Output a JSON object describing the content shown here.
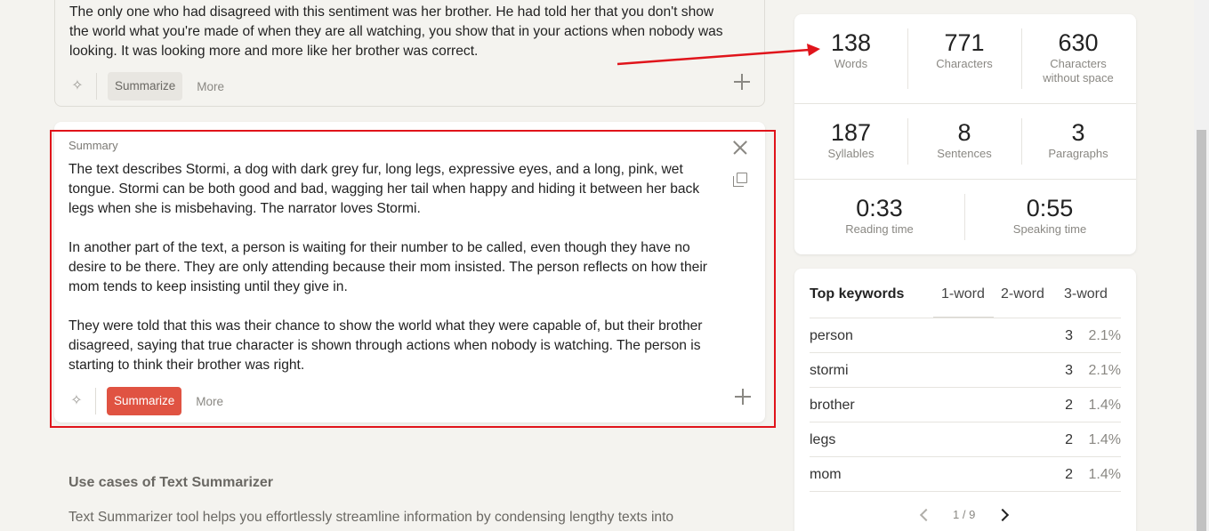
{
  "top_card": {
    "text": "The only one who had disagreed with this sentiment was her brother. He had told her that you don't show the world what you're made of when they are all watching, you show that in your actions when nobody was looking. It was looking more and more like her brother was correct.",
    "summarize_label": "Summarize",
    "more_label": "More"
  },
  "summary_card": {
    "label": "Summary",
    "paragraphs": [
      "The text describes Stormi, a dog with dark grey fur, long legs, expressive eyes, and a long, pink, wet tongue. Stormi can be both good and bad, wagging her tail when happy and hiding it between her back legs when she is misbehaving. The narrator loves Stormi.",
      "In another part of the text, a person is waiting for their number to be called, even though they have no desire to be there. They are only attending because their mom insisted. The person reflects on how their mom tends to keep insisting until they give in.",
      "They were told that this was their chance to show the world what they were capable of, but their brother disagreed, saying that true character is shown through actions when nobody is watching. The person is starting to think their brother was right."
    ],
    "summarize_label": "Summarize",
    "more_label": "More"
  },
  "section": {
    "title": "Use cases of Text Summarizer",
    "text": "Text Summarizer tool helps you effortlessly streamline information by condensing lengthy texts into"
  },
  "stats": {
    "words": {
      "value": "138",
      "label": "Words"
    },
    "characters": {
      "value": "771",
      "label": "Characters"
    },
    "characters_no_space": {
      "value": "630",
      "label_1": "Characters",
      "label_2": "without space"
    },
    "syllables": {
      "value": "187",
      "label": "Syllables"
    },
    "sentences": {
      "value": "8",
      "label": "Sentences"
    },
    "paragraphs": {
      "value": "3",
      "label": "Paragraphs"
    },
    "reading_time": {
      "value": "0:33",
      "label": "Reading time"
    },
    "speaking_time": {
      "value": "0:55",
      "label": "Speaking time"
    }
  },
  "keywords": {
    "title": "Top keywords",
    "tabs": [
      "1-word",
      "2-word",
      "3-word"
    ],
    "rows": [
      {
        "word": "person",
        "count": "3",
        "pct": "2.1%"
      },
      {
        "word": "stormi",
        "count": "3",
        "pct": "2.1%"
      },
      {
        "word": "brother",
        "count": "2",
        "pct": "1.4%"
      },
      {
        "word": "legs",
        "count": "2",
        "pct": "1.4%"
      },
      {
        "word": "mom",
        "count": "2",
        "pct": "1.4%"
      }
    ],
    "page": "1 / 9"
  },
  "colors": {
    "accent": "#e05342",
    "annotation": "#e0141b",
    "background": "#f4f3ef"
  }
}
